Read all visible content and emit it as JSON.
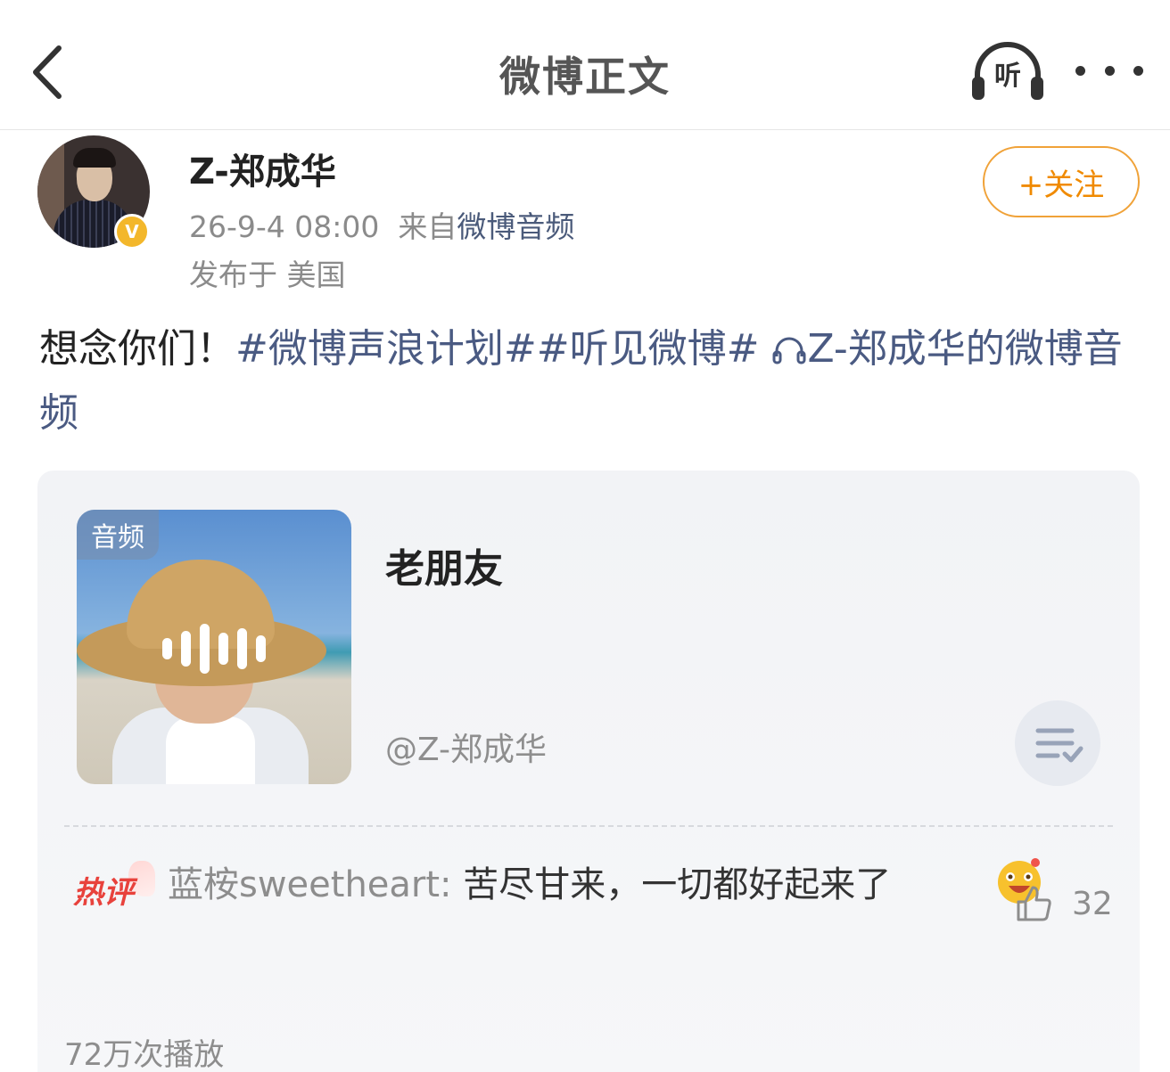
{
  "nav": {
    "title": "微博正文",
    "listen_label": "听"
  },
  "author": {
    "name": "Z-郑成华",
    "verified_badge": "V",
    "date": "26-9-4 08:00",
    "source_prefix": "来自",
    "source": "微博音频",
    "location": "发布于 美国",
    "follow_label": "+关注"
  },
  "post": {
    "text": "想念你们！",
    "topics": [
      "#微博声浪计划#",
      "#听见微博#"
    ],
    "audio_link": "Z-郑成华的微博音频"
  },
  "audio_card": {
    "cover_tag": "音频",
    "title": "老朋友",
    "artist": "@Z-郑成华",
    "hot_badge": "热评",
    "comment_user": "蓝桉sweetheart:",
    "comment_text": " 苦尽甘来，一切都好起来了",
    "comment_emoji": "laughing-emoji",
    "likes": "32",
    "plays": "72万次播放"
  },
  "colors": {
    "accent_orange": "#f08a00",
    "topic_blue": "#4a5a82",
    "hot_red": "#e8423c",
    "verified_gold": "#f3b72b"
  }
}
